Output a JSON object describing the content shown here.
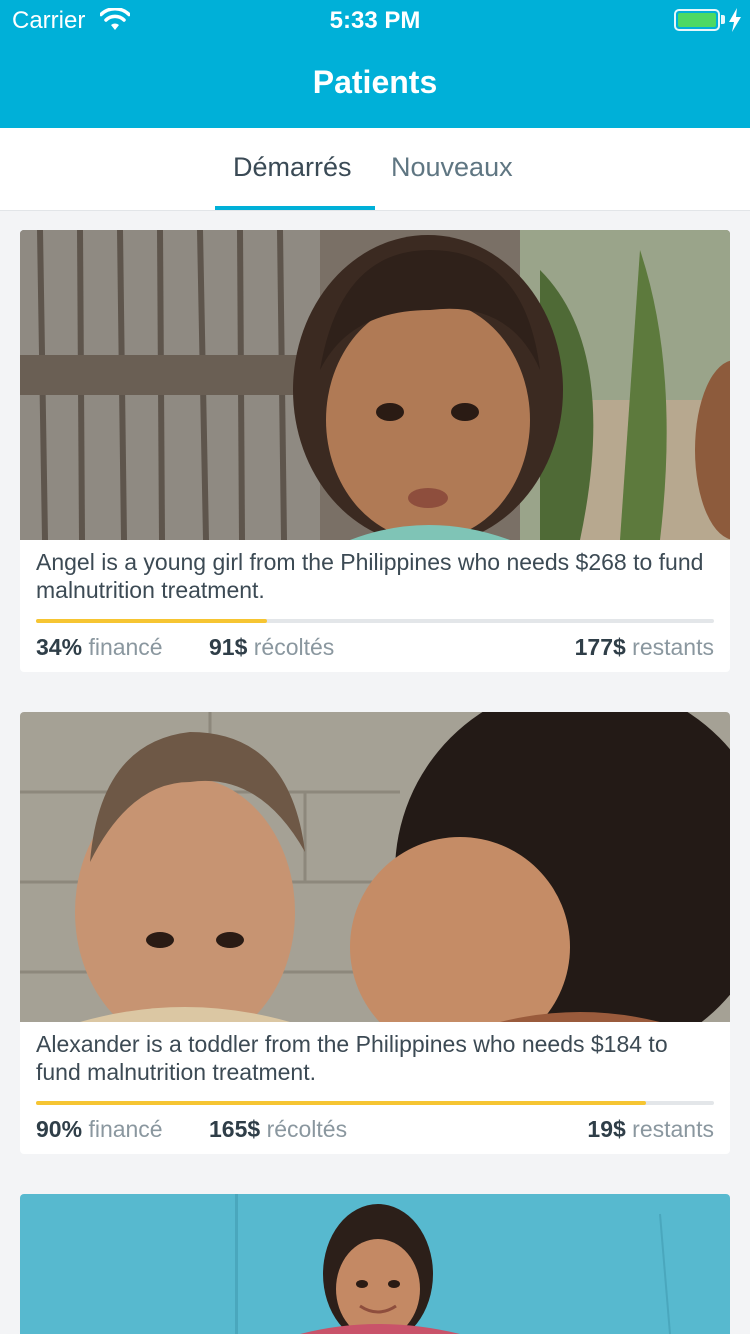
{
  "status_bar": {
    "carrier": "Carrier",
    "time": "5:33 PM",
    "battery_color": "#4cd964"
  },
  "nav": {
    "title": "Patients",
    "bar_color": "#00b0d8"
  },
  "tabs": [
    {
      "label": "Démarrés",
      "active": true
    },
    {
      "label": "Nouveaux",
      "active": false
    }
  ],
  "patients": [
    {
      "description": "Angel is a young girl from the Philippines who needs $268 to fund malnutrition treatment.",
      "funded_pct": "34%",
      "funded_label": "financé",
      "raised": "91$",
      "raised_label": "récoltés",
      "remaining": "177$",
      "remaining_label": "restants",
      "progress": 0.34
    },
    {
      "description": "Alexander is a toddler from the Philippines who needs $184 to fund malnutrition treatment.",
      "funded_pct": "90%",
      "funded_label": "financé",
      "raised": "165$",
      "raised_label": "récoltés",
      "remaining": "19$",
      "remaining_label": "restants",
      "progress": 0.9
    }
  ]
}
